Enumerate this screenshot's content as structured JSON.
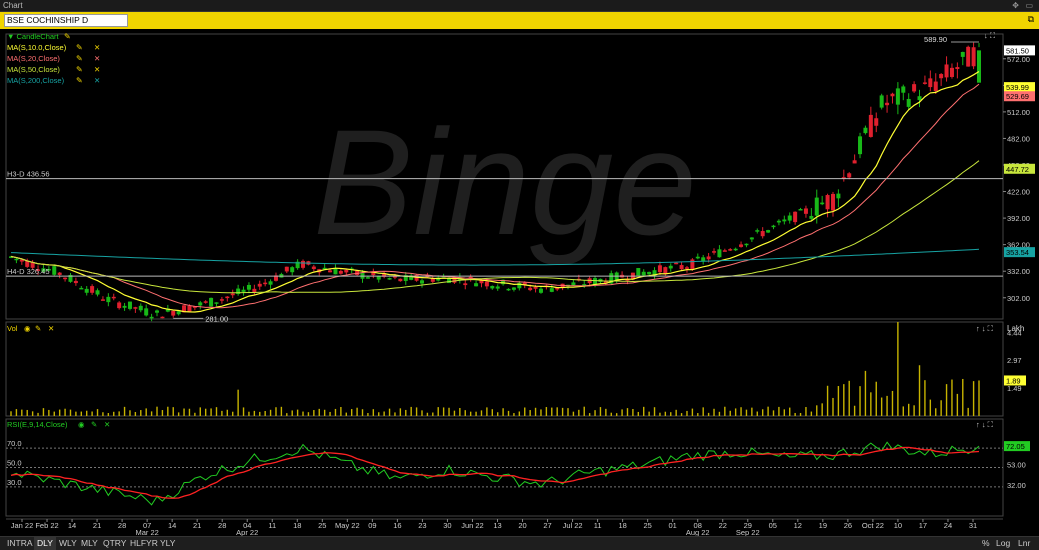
{
  "window": {
    "title": "Chart"
  },
  "symbol": {
    "value": "BSE COCHINSHIP D"
  },
  "legend": {
    "candle": "CandleChart",
    "ma10": "MA(S,10.0,Close)",
    "ma20": "MA(S,20,Close)",
    "ma50": "MA(S,50,Close)",
    "ma200": "MA(S,200,Close)",
    "vol": "Vol",
    "rsi": "RSI(E,9,14,Close)"
  },
  "colors": {
    "ma10": "#ffff33",
    "ma20": "#ff7070",
    "ma50": "#c8e63c",
    "ma200": "#17a3a3",
    "up": "#18b818",
    "down": "#e0202e",
    "volume": "#c8b400",
    "rsi": "#22cc22",
    "rsi_signal": "#ff2222"
  },
  "price_panel": {
    "hlines": [
      {
        "label": "H3-D 436.56",
        "value": 436.56
      },
      {
        "label": "H4-D 326.45",
        "value": 326.45
      }
    ],
    "annotations": {
      "high": "589.90",
      "low": "281.00"
    },
    "last_labels": [
      {
        "text": "581.50",
        "value": 581.5,
        "bg": "#ffffff",
        "fg": "#000000"
      },
      {
        "text": "539.99",
        "value": 539.99,
        "bg": "#ffff33",
        "fg": "#000000"
      },
      {
        "text": "529.69",
        "value": 529.69,
        "bg": "#ff7070",
        "fg": "#000000"
      },
      {
        "text": "447.72",
        "value": 447.72,
        "bg": "#c8e63c",
        "fg": "#000000"
      },
      {
        "text": "353.54",
        "value": 353.54,
        "bg": "#17a3a3",
        "fg": "#000000"
      }
    ],
    "yticks": [
      "572.00",
      "542.00",
      "512.00",
      "482.00",
      "452.00",
      "422.00",
      "392.00",
      "362.00",
      "332.00",
      "302.00"
    ],
    "watermark": "Binge"
  },
  "volume_panel": {
    "unit": "Lakh",
    "yticks": [
      "4.44",
      "2.97",
      "1.49"
    ],
    "last_label": "1.89"
  },
  "rsi_panel": {
    "yticks": [
      "70.0",
      "50.0",
      "30.0"
    ],
    "right_ticks": [
      "53.00",
      "32.00"
    ],
    "last_label": "72.05"
  },
  "xaxis": {
    "ticks": [
      "Jan 22",
      "Feb 22",
      "14",
      "21",
      "28",
      "07",
      "14",
      "21",
      "28",
      "04",
      "11",
      "18",
      "25",
      "May 22",
      "09",
      "16",
      "23",
      "30",
      "Jun 22",
      "13",
      "20",
      "27",
      "Jul 22",
      "11",
      "18",
      "25",
      "01",
      "08",
      "22",
      "29",
      "05",
      "12",
      "19",
      "26",
      "Oct 22",
      "10",
      "17",
      "24",
      "31"
    ],
    "month_labels": [
      "Mar 22",
      "Apr 22",
      "Aug 22",
      "Sep 22"
    ]
  },
  "timeframes": [
    "INTRA",
    "DLY",
    "WLY",
    "MLY",
    "QTRY",
    "HLFYR",
    "YLY"
  ],
  "active_timeframe": "DLY",
  "bottom_right": [
    "%",
    "Log",
    "Lnr"
  ],
  "chart_data": {
    "type": "candlestick",
    "title": "BSE COCHINSHIP D",
    "ylim": [
      281,
      590
    ],
    "x": [
      "2022-01-24",
      "2022-02-07",
      "2022-02-21",
      "2022-03-07",
      "2022-03-21",
      "2022-04-04",
      "2022-04-18",
      "2022-05-02",
      "2022-05-16",
      "2022-05-30",
      "2022-06-13",
      "2022-06-27",
      "2022-07-11",
      "2022-07-25",
      "2022-08-08",
      "2022-08-22",
      "2022-09-05",
      "2022-09-19",
      "2022-10-03",
      "2022-10-17",
      "2022-10-31"
    ],
    "close": [
      348,
      330,
      300,
      283,
      295,
      312,
      340,
      330,
      322,
      325,
      318,
      312,
      320,
      330,
      338,
      362,
      388,
      415,
      520,
      540,
      581.5
    ],
    "rsi": [
      45,
      35,
      25,
      15,
      42,
      58,
      70,
      52,
      38,
      48,
      40,
      33,
      45,
      52,
      62,
      66,
      60,
      63,
      73,
      64,
      72
    ],
    "series_values": {
      "last_close": 581.5,
      "ma10": 539.99,
      "ma20": 529.69,
      "ma50": 447.72,
      "ma200": 353.54,
      "high": 589.9,
      "low": 281.0,
      "volume_last": 1.89,
      "rsi_last": 72.05
    }
  }
}
